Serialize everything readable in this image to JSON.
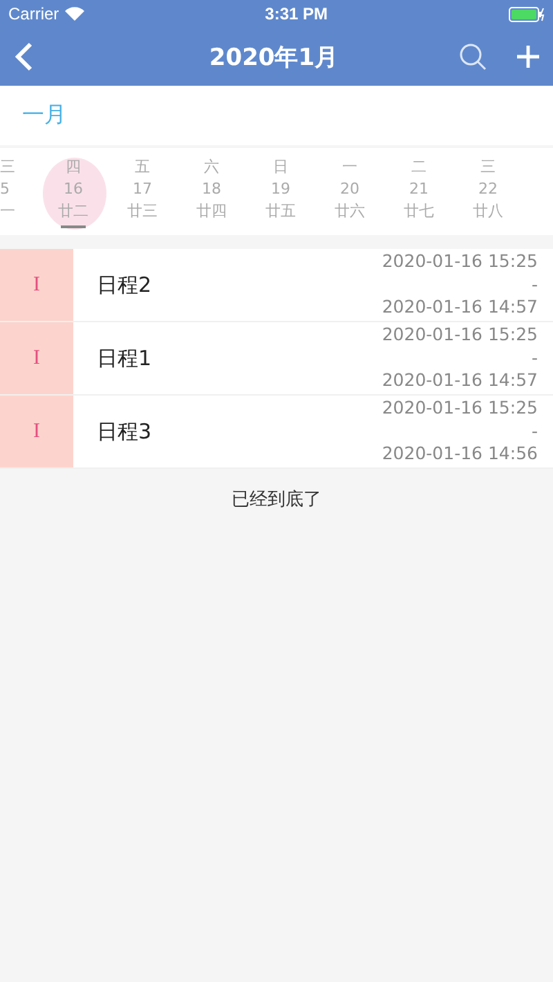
{
  "status_bar": {
    "carrier": "Carrier",
    "time": "3:31 PM"
  },
  "nav": {
    "title": "2020年1月"
  },
  "month": {
    "label": "一月"
  },
  "days": [
    {
      "weekday": "三",
      "date": "5",
      "lunar": "一",
      "selected": false,
      "kind": "cut"
    },
    {
      "weekday": "四",
      "date": "16",
      "lunar": "廿二",
      "selected": true,
      "kind": "full"
    },
    {
      "weekday": "五",
      "date": "17",
      "lunar": "廿三",
      "selected": false,
      "kind": "full"
    },
    {
      "weekday": "六",
      "date": "18",
      "lunar": "廿四",
      "selected": false,
      "kind": "full"
    },
    {
      "weekday": "日",
      "date": "19",
      "lunar": "廿五",
      "selected": false,
      "kind": "full"
    },
    {
      "weekday": "一",
      "date": "20",
      "lunar": "廿六",
      "selected": false,
      "kind": "full"
    },
    {
      "weekday": "二",
      "date": "21",
      "lunar": "廿七",
      "selected": false,
      "kind": "full"
    },
    {
      "weekday": "三",
      "date": "22",
      "lunar": "廿八",
      "selected": false,
      "kind": "full"
    }
  ],
  "events": [
    {
      "mark": "I",
      "title": "日程2",
      "start": "2020-01-16 15:25",
      "separator": "-",
      "end": "2020-01-16 14:57"
    },
    {
      "mark": "I",
      "title": "日程1",
      "start": "2020-01-16 15:25",
      "separator": "-",
      "end": "2020-01-16 14:57"
    },
    {
      "mark": "I",
      "title": "日程3",
      "start": "2020-01-16 15:25",
      "separator": "-",
      "end": "2020-01-16 14:56"
    }
  ],
  "footer": "已经到底了"
}
